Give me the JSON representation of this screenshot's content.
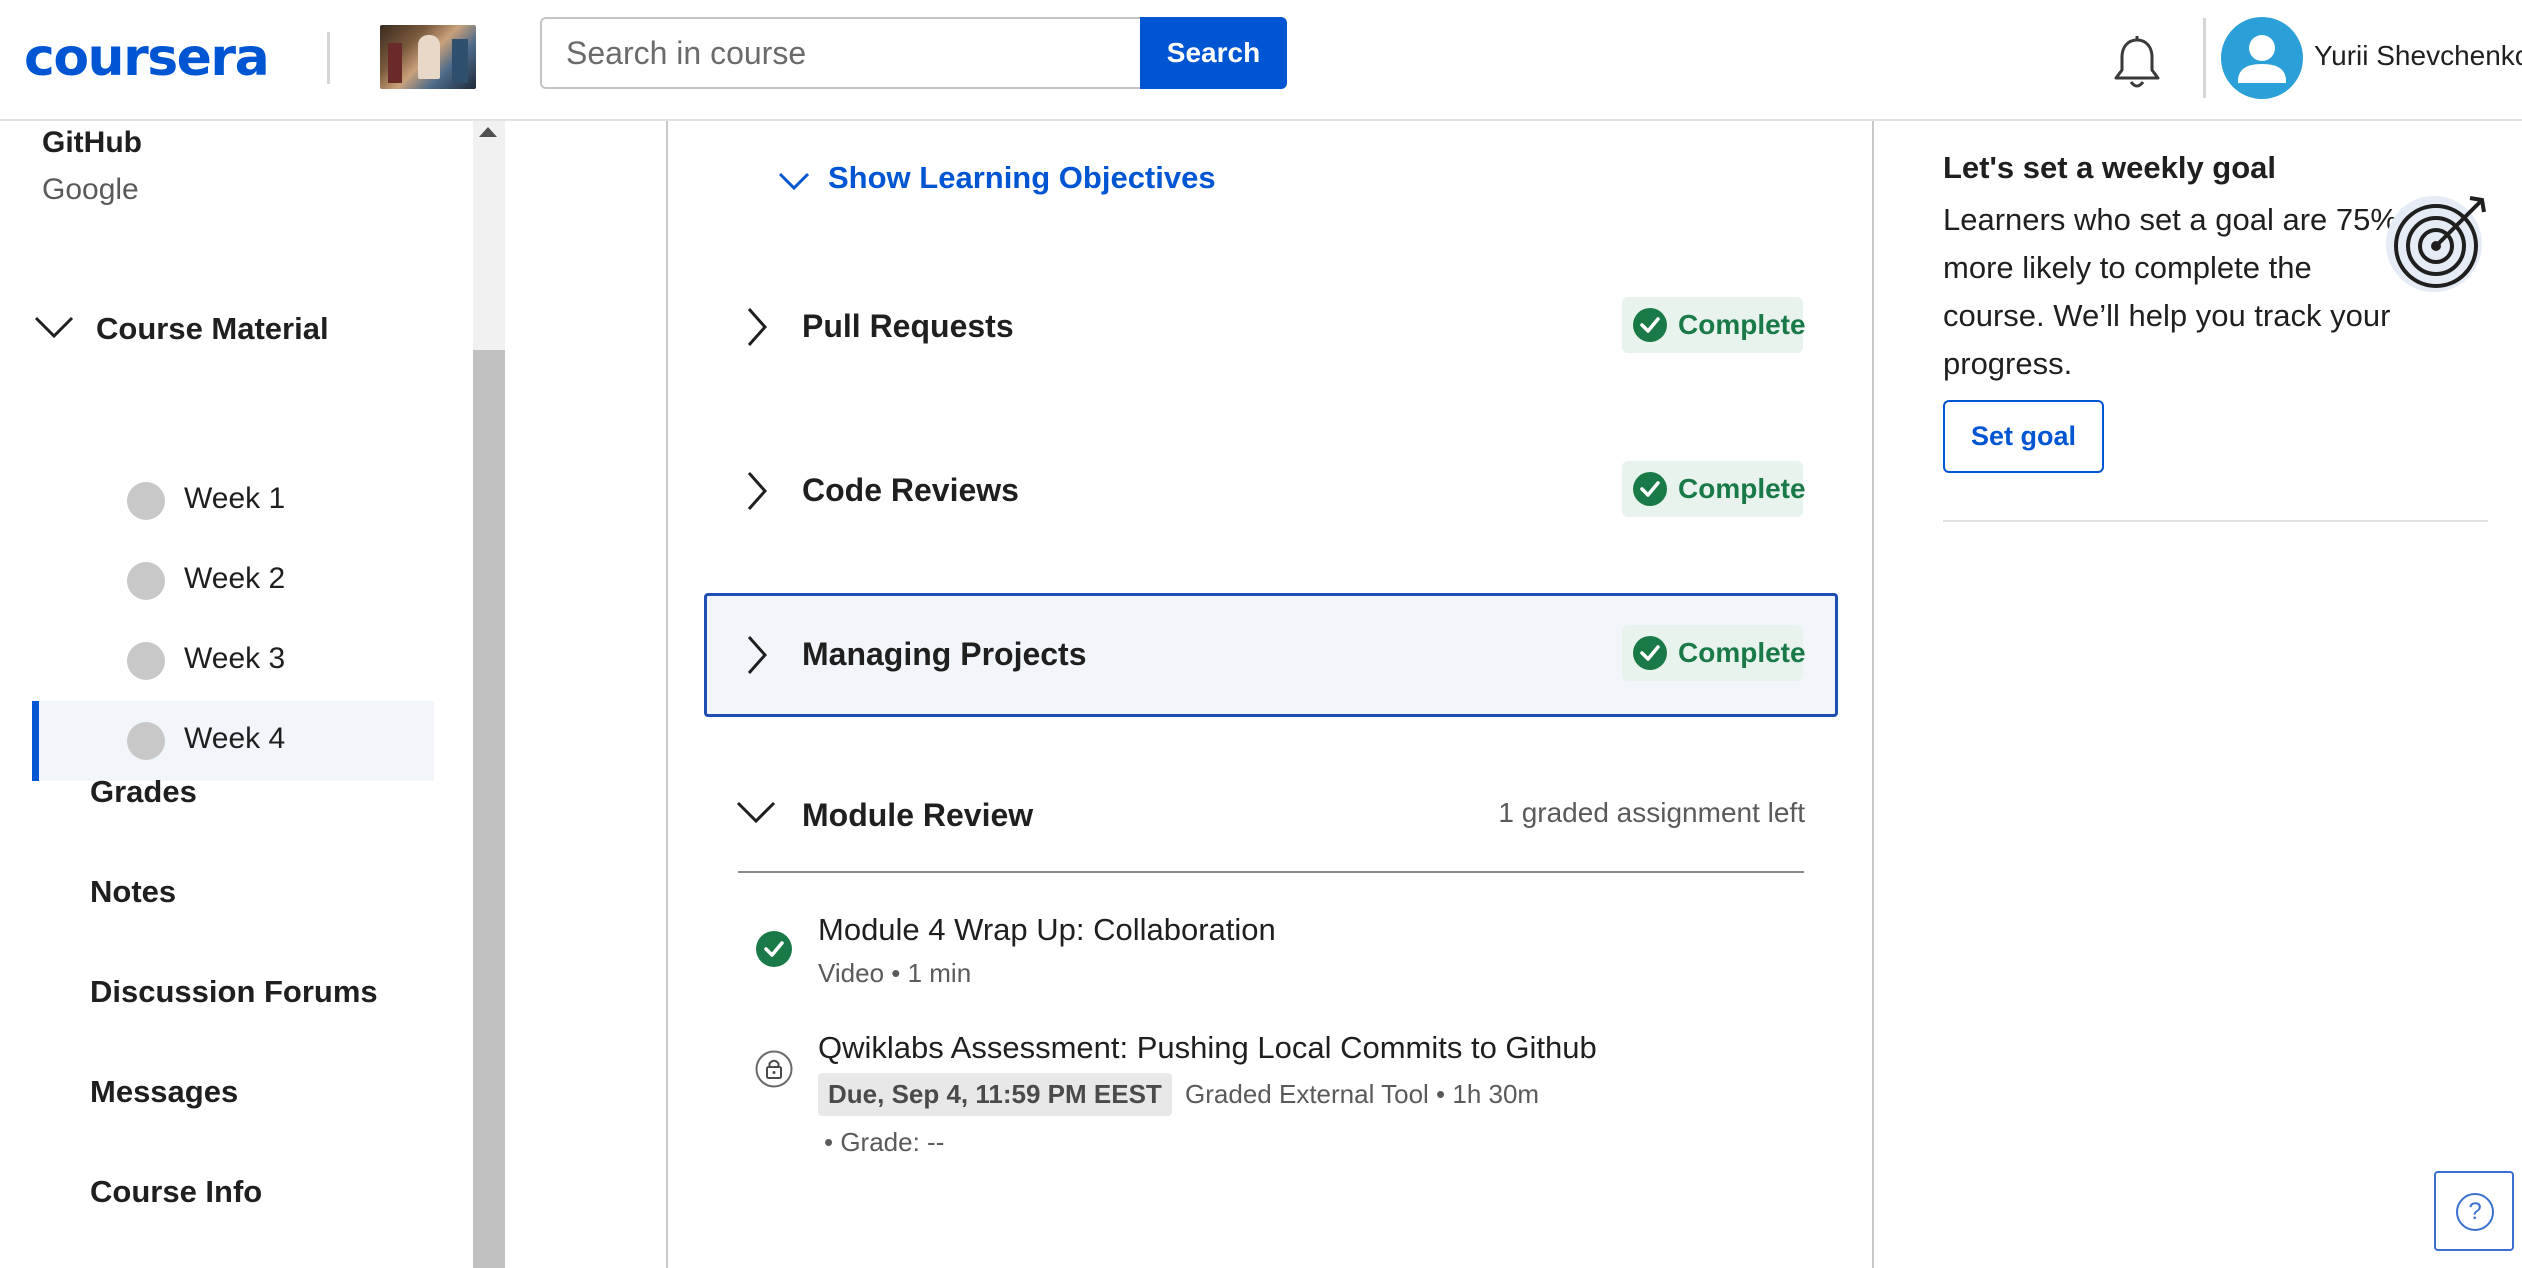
{
  "header": {
    "logo_text": "coursera",
    "search_placeholder": "Search in course",
    "search_button": "Search",
    "user_name": "Yurii Shevchenko"
  },
  "sidebar": {
    "partner_line1": "GitHub",
    "partner_line2": "Google",
    "course_material_label": "Course Material",
    "weeks": [
      {
        "label": "Week 1"
      },
      {
        "label": "Week 2"
      },
      {
        "label": "Week 3"
      },
      {
        "label": "Week 4"
      }
    ],
    "nav_links": [
      {
        "label": "Grades"
      },
      {
        "label": "Notes"
      },
      {
        "label": "Discussion Forums"
      },
      {
        "label": "Messages"
      },
      {
        "label": "Course Info"
      }
    ]
  },
  "main": {
    "show_objectives": "Show Learning Objectives",
    "lessons": [
      {
        "title": "Pull Requests",
        "status": "Complete"
      },
      {
        "title": "Code Reviews",
        "status": "Complete"
      },
      {
        "title": "Managing Projects",
        "status": "Complete"
      }
    ],
    "module_review": {
      "title": "Module Review",
      "assignments_left": "1 graded assignment left",
      "items": [
        {
          "title": "Module 4 Wrap Up: Collaboration",
          "meta": "Video • 1 min"
        },
        {
          "title": "Qwiklabs Assessment: Pushing Local Commits to Github",
          "due": "Due, Sep 4, 11:59 PM EEST",
          "meta": "Graded External Tool • 1h 30m",
          "grade": "• Grade: --"
        }
      ]
    }
  },
  "right_panel": {
    "goal_title": "Let's set a weekly goal",
    "goal_text": "Learners who set a goal are 75% more likely to complete the course. We’ll help you track your progress.",
    "set_goal_button": "Set goal"
  },
  "help_button": "?",
  "colors": {
    "brand_blue": "#0056d2",
    "complete_green": "#1a7a47",
    "complete_bg": "#e7f3ec"
  }
}
